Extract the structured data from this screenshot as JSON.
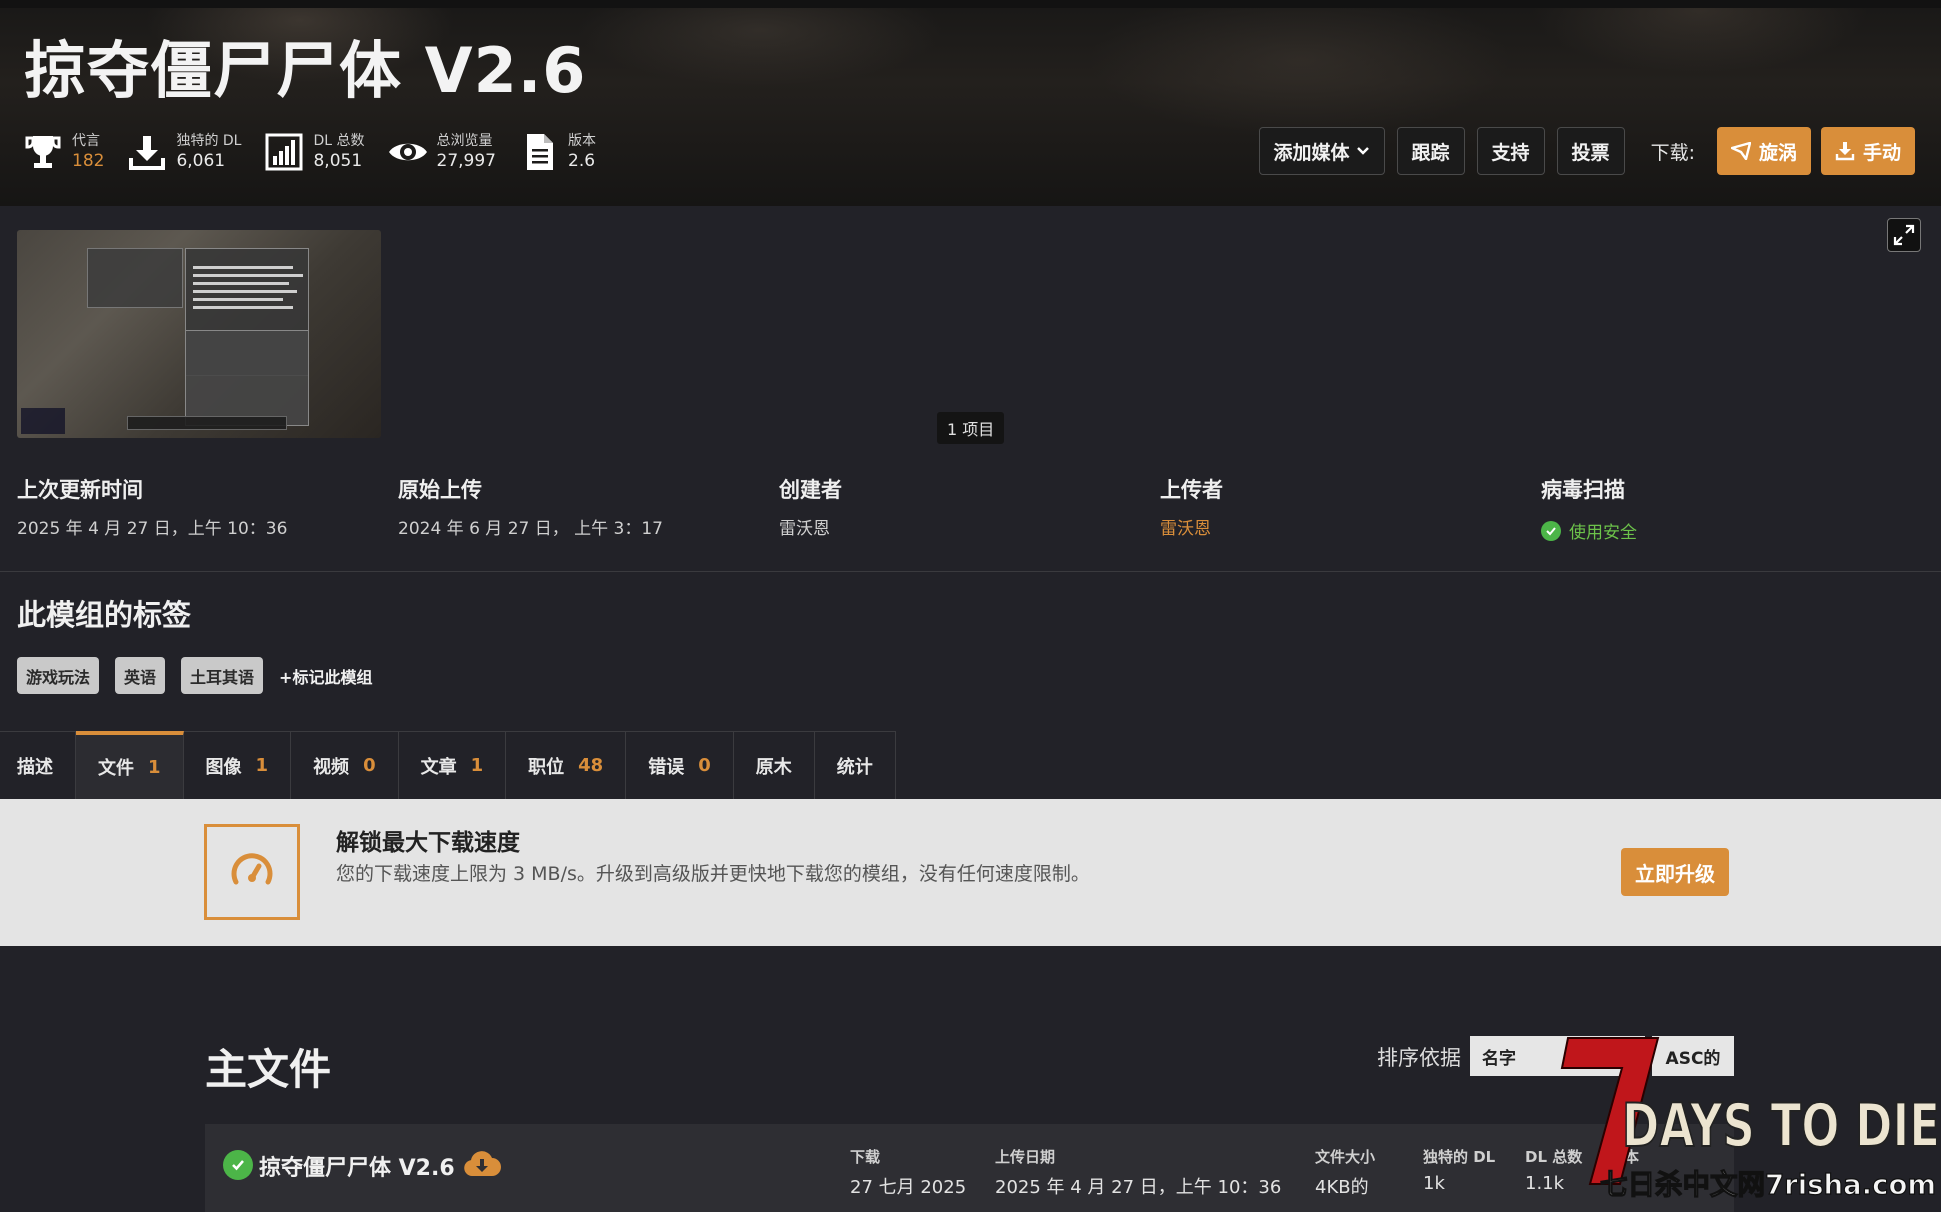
{
  "header": {
    "title": "掠夺僵尸尸体 V2.6",
    "stats": [
      {
        "icon": "trophy-icon",
        "label": "代言",
        "value": "182",
        "accent": true
      },
      {
        "icon": "download-icon",
        "label": "独特的 DL",
        "value": "6,061"
      },
      {
        "icon": "bar-chart-icon",
        "label": "DL 总数",
        "value": "8,051"
      },
      {
        "icon": "eye-icon",
        "label": "总浏览量",
        "value": "27,997"
      },
      {
        "icon": "document-icon",
        "label": "版本",
        "value": "2.6"
      }
    ],
    "actions": {
      "add_media": "添加媒体",
      "track": "跟踪",
      "support": "支持",
      "vote": "投票",
      "download_label": "下载:",
      "vortex": "旋涡",
      "manual": "手动"
    }
  },
  "gallery": {
    "count_label": "1 项目"
  },
  "meta": [
    {
      "label": "上次更新时间",
      "value": "2025 年 4 月 27 日，上午 10：36"
    },
    {
      "label": "原始上传",
      "value": "2024 年 6 月 27 日，  上午 3：17"
    },
    {
      "label": "创建者",
      "value": "雷沃恩"
    },
    {
      "label": "上传者",
      "value": "雷沃恩",
      "accent": true
    },
    {
      "label": "病毒扫描",
      "value": "使用安全",
      "status": "safe"
    }
  ],
  "tags": {
    "title": "此模组的标签",
    "items": [
      "游戏玩法",
      "英语",
      "土耳其语"
    ],
    "add_label": "+标记此模组"
  },
  "tabs": [
    {
      "label": "描述"
    },
    {
      "label": "文件",
      "count": "1",
      "active": true
    },
    {
      "label": "图像",
      "count": "1"
    },
    {
      "label": "视频",
      "count": "0"
    },
    {
      "label": "文章",
      "count": "1"
    },
    {
      "label": "职位",
      "count": "48"
    },
    {
      "label": "错误",
      "count": "0"
    },
    {
      "label": "原木"
    },
    {
      "label": "统计"
    }
  ],
  "promo": {
    "title": "解锁最大下载速度",
    "text": "您的下载速度上限为 3 MB/s。升级到高级版并更快地下载您的模组，没有任何速度限制。",
    "button": "立即升级"
  },
  "files": {
    "title": "主文件",
    "sort_label": "排序依据",
    "sort_value": "名字",
    "sort_dir": "ASC的",
    "items": [
      {
        "name": "掠夺僵尸尸体 V2.6",
        "columns": [
          {
            "label": "下载",
            "value": "27 七月 2025"
          },
          {
            "label": "上传日期",
            "value": "2025 年 4 月 27 日，上午 10：36"
          },
          {
            "label": "文件大小",
            "value": "4KB的"
          },
          {
            "label": "独特的 DL",
            "value": "1k"
          },
          {
            "label": "DL 总数",
            "value": "1.1k"
          },
          {
            "label": "版本",
            "value": ""
          }
        ]
      }
    ]
  },
  "watermark": {
    "logo_text": "DAYS TO DIE",
    "logo_number": "7",
    "site_text": "七日杀中文网7risha.com"
  },
  "colors": {
    "accent": "#d98e3a",
    "safe": "#4cb548",
    "background": "#222228"
  }
}
